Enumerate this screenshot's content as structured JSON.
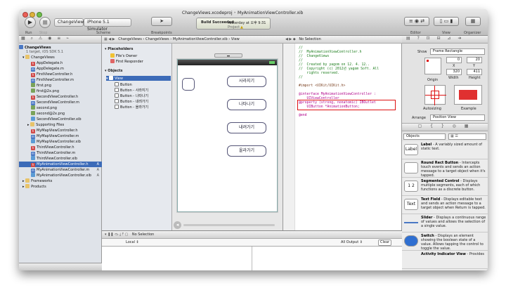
{
  "window": {
    "title": "ChangeViews.xcodeproj — MyAnimationViewController.xib"
  },
  "title_bar": {
    "project": "ChangeViews.xcodeproj",
    "file": "MyAnimationViewController.xib"
  },
  "toolbar": {
    "run_label": "Run",
    "stop_label": "Stop",
    "scheme_target": "ChangeViews",
    "scheme_device": "iPhone 5.1 Simulator",
    "scheme_label": "Scheme",
    "breakpoints_label": "Breakpoints",
    "status_title": "Build Succeeded",
    "status_time": "Yesterday at 오후 9:31",
    "project_label": "Project",
    "editor_label": "Editor",
    "view_label": "View",
    "organizer_label": "Organizer"
  },
  "navigator": {
    "project": "ChangeViews",
    "project_sub": "1 target, iOS SDK 5.1",
    "items": [
      {
        "label": "ChangeViews",
        "kind": "group"
      },
      {
        "label": "AppDelegate.h",
        "kind": "h"
      },
      {
        "label": "AppDelegate.m",
        "kind": "m"
      },
      {
        "label": "FirstViewController.h",
        "kind": "h"
      },
      {
        "label": "FirstViewController.m",
        "kind": "m"
      },
      {
        "label": "first.png",
        "kind": "png"
      },
      {
        "label": "first@2x.png",
        "kind": "png"
      },
      {
        "label": "SecondViewController.h",
        "kind": "h"
      },
      {
        "label": "SecondViewController.m",
        "kind": "m"
      },
      {
        "label": "second.png",
        "kind": "png"
      },
      {
        "label": "second@2x.png",
        "kind": "png"
      },
      {
        "label": "SecondViewController.xib",
        "kind": "xib"
      },
      {
        "label": "Supporting Files",
        "kind": "group"
      },
      {
        "label": "MyMapViewController.h",
        "kind": "h"
      },
      {
        "label": "MyMapViewController.m",
        "kind": "m"
      },
      {
        "label": "MyMapViewController.xib",
        "kind": "xib"
      },
      {
        "label": "ThirdViewController.h",
        "kind": "h"
      },
      {
        "label": "ThirdViewController.m",
        "kind": "m"
      },
      {
        "label": "ThirdViewController.xib",
        "kind": "xib"
      },
      {
        "label": "MyAnimationViewController.h",
        "kind": "h",
        "badge": "A"
      },
      {
        "label": "MyAnimationViewController.m",
        "kind": "m",
        "badge": "A"
      },
      {
        "label": "MyAnimationViewController.xib",
        "kind": "xib",
        "badge": "A"
      },
      {
        "label": "Frameworks",
        "kind": "group"
      },
      {
        "label": "Products",
        "kind": "group"
      }
    ]
  },
  "jump_bar": {
    "crumbs": [
      "ChangeViews",
      "ChangeViews",
      "MyAnimationViewController.xib",
      "View"
    ],
    "right": "No Selection"
  },
  "outline": {
    "placeholders_title": "Placeholders",
    "placeholders": [
      "File's Owner",
      "First Responder"
    ],
    "objects_title": "Objects",
    "view": "View",
    "buttons": [
      "Button",
      "Button - 사라지기",
      "Button - 나타나기",
      "Button - 내려가기",
      "Button - 올라가기"
    ]
  },
  "canvas": {
    "buttons": [
      "사라지기",
      "나타나기",
      "내려가기",
      "올라가기"
    ]
  },
  "code": [
    {
      "text": "//",
      "cls": ""
    },
    {
      "text": "//  MyAnimationViewController.h",
      "cls": ""
    },
    {
      "text": "//  ChangeViews",
      "cls": ""
    },
    {
      "text": "//",
      "cls": ""
    },
    {
      "text": "//  Created by yagom on 12. 4. 12..",
      "cls": ""
    },
    {
      "text": "//  Copyright (c) 2012년 yagom Soft. All",
      "cls": ""
    },
    {
      "text": "    rights reserved.",
      "cls": ""
    },
    {
      "text": "//",
      "cls": ""
    },
    {
      "text": "",
      "cls": ""
    },
    {
      "text": "#import <UIKit/UIKit.h>",
      "cls": "pp"
    },
    {
      "text": "",
      "cls": ""
    },
    {
      "text": "@interface MyAnimationViewController :",
      "cls": "kw"
    },
    {
      "text": "    UIViewController",
      "cls": "kw"
    },
    {
      "text": "@property (strong, nonatomic) IBOutlet",
      "cls": "kw"
    },
    {
      "text": "    UIButton *AnimationButton;",
      "cls": "kw"
    },
    {
      "text": "",
      "cls": ""
    },
    {
      "text": "@end",
      "cls": "kw"
    }
  ],
  "debug": {
    "bar_right": "No Selection",
    "local": "Local",
    "all_output": "All Output",
    "clear": "Clear"
  },
  "inspector": {
    "show_label": "Show",
    "show_value": "Frame Rectangle",
    "x": "0",
    "y": "20",
    "w": "320",
    "h": "411",
    "x_label": "X",
    "y_label": "Y",
    "width_label": "Width",
    "height_label": "Height",
    "origin_label": "Origin",
    "autosizing_label": "Autosizing",
    "example_label": "Example",
    "arrange_label": "Arrange",
    "arrange_value": "Position View",
    "library_filter": "Objects",
    "library": [
      {
        "icon": "Label",
        "name": "Label",
        "desc": " - A variably sized amount of static text."
      },
      {
        "icon": "",
        "name": "Round Rect Button",
        "desc": " - Intercepts touch events and sends an action message to a target object when it's tapped."
      },
      {
        "icon": "1 2",
        "name": "Segmented Control",
        "desc": " - Displays multiple segments, each of which functions as a discrete button."
      },
      {
        "icon": "Text",
        "name": "Text Field",
        "desc": " - Displays editable text and sends an action message to a target object when Return is tapped."
      },
      {
        "icon": "",
        "name": "Slider",
        "desc": " - Displays a continuous range of values and allows the selection of a single value."
      },
      {
        "icon": "",
        "name": "Switch",
        "desc": " - Displays an element showing the boolean state of a value. Allows tapping the control to toggle the value."
      },
      {
        "icon": "",
        "name": "Activity Indicator View",
        "desc": " - Provides"
      }
    ]
  }
}
